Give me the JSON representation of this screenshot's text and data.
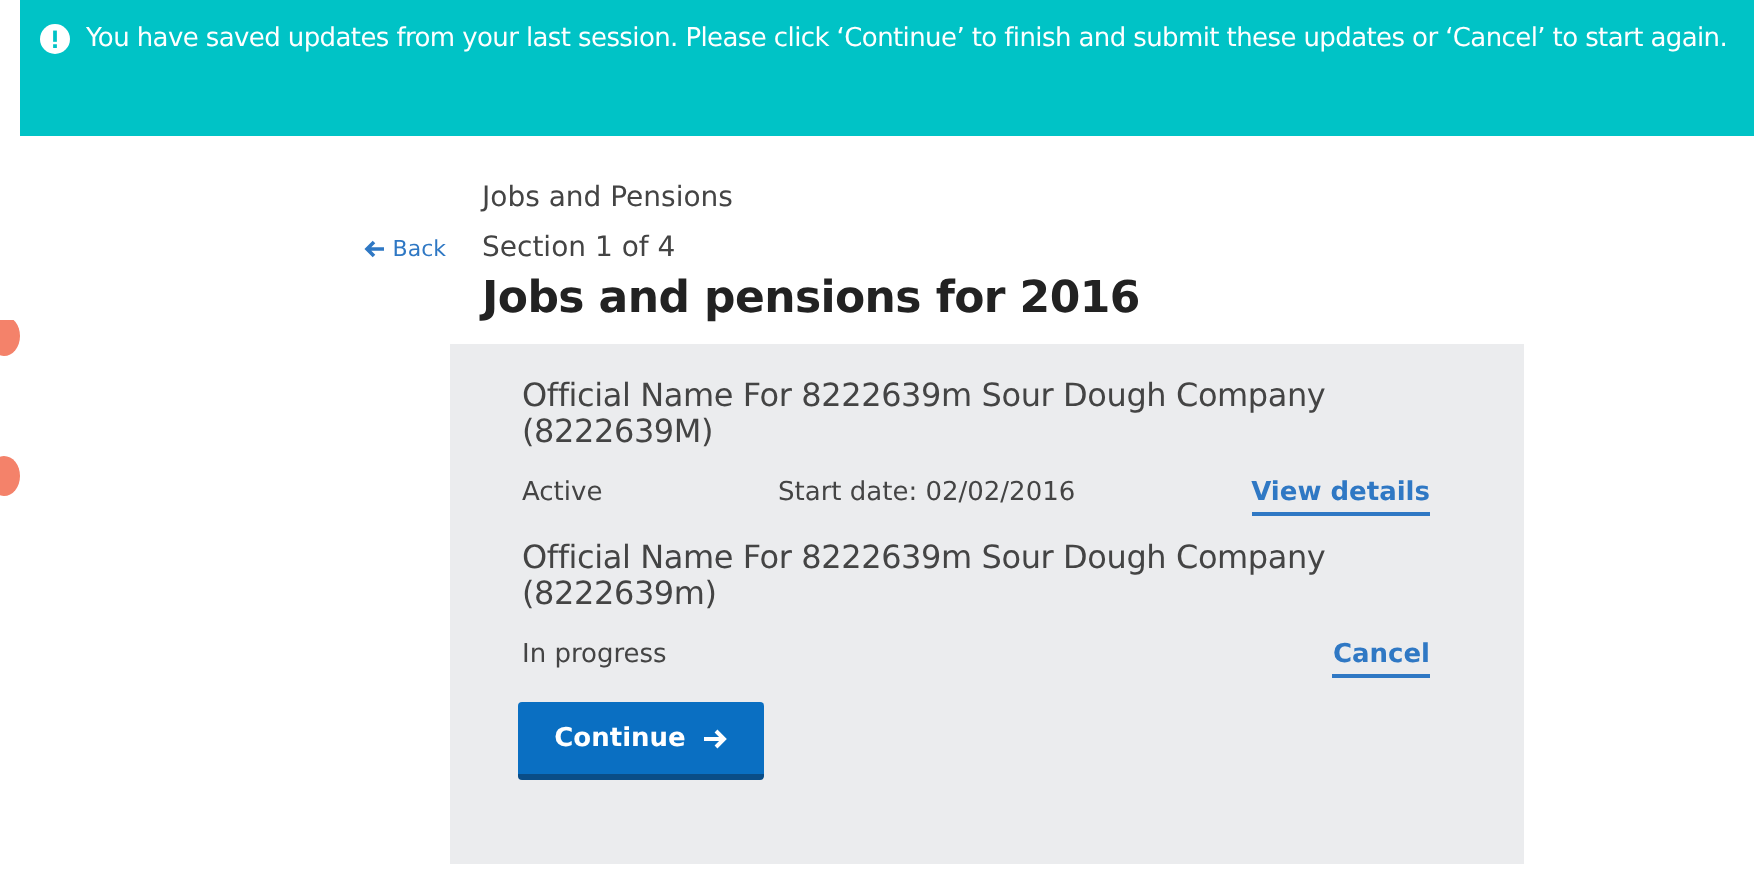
{
  "alert": {
    "text": "You have saved updates from your last session. Please click ‘Continue’ to finish and submit these updates or ‘Cancel’ to start again."
  },
  "back_link": {
    "label": "Back"
  },
  "breadcrumb": "Jobs and Pensions",
  "section": "Section 1 of 4",
  "heading": "Jobs and pensions for 2016",
  "employments": [
    {
      "name": "Official Name For 8222639m Sour Dough Company (8222639M)",
      "status": "Active",
      "start_date": "Start date: 02/02/2016",
      "action": "View details"
    },
    {
      "name": "Official Name For 8222639m Sour Dough Company (8222639m)",
      "status": "In progress",
      "action": "Cancel"
    }
  ],
  "continue_button": {
    "label": "Continue"
  }
}
